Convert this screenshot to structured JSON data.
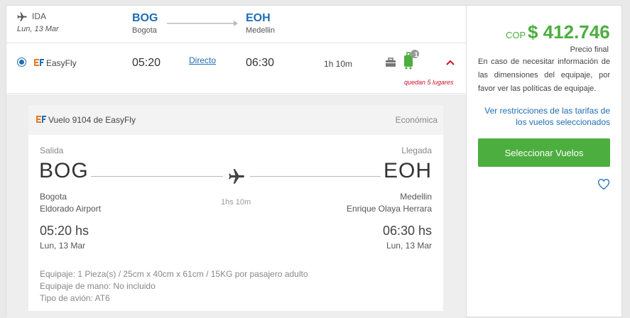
{
  "header": {
    "direction": "IDA",
    "date": "Lun, 13 Mar",
    "origin": {
      "code": "BOG",
      "city": "Bogota"
    },
    "destination": {
      "code": "EOH",
      "city": "Medellin"
    }
  },
  "flight_row": {
    "airline": "EasyFly",
    "departure": "05:20",
    "stops": "Directo",
    "arrival": "06:30",
    "duration": "1h 10m",
    "luggage_count": "1",
    "seats_left": "quedan 5 lugares"
  },
  "detail": {
    "flight_title": "Vuelo 9104 de EasyFly",
    "cabin": "Económica",
    "departure_label": "Salida",
    "arrival_label": "Llegada",
    "origin_code": "BOG",
    "destination_code": "EOH",
    "origin_city": "Bogota",
    "destination_city": "Medellin",
    "origin_airport": "Eldorado Airport",
    "destination_airport": "Enrique Olaya Herrara",
    "duration": "1hs 10m",
    "departure_time": "05:20 hs",
    "arrival_time": "06:30 hs",
    "departure_date": "Lun, 13 Mar",
    "arrival_date": "Lun, 13 Mar",
    "baggage": "Equipaje: 1 Pieza(s) / 25cm x 40cm x 61cm / 15KG por pasajero adulto",
    "hand_baggage": "Equipaje de mano: No incluido",
    "aircraft": "Tipo de avión: AT6"
  },
  "price": {
    "currency": "COP",
    "amount": "$ 412.746",
    "label": "Precio final",
    "note": "En caso de necesitar información de las dimensiones del equipaje, por favor ver las políticas de equipaje.",
    "restrictions_link": "Ver restricciones de las tarifas de los vuelos seleccionados",
    "select_button": "Seleccionar Vuelos"
  },
  "colors": {
    "brand_blue": "#1d6db5",
    "price_green": "#4cae3f",
    "alert_red": "#c8102e"
  }
}
